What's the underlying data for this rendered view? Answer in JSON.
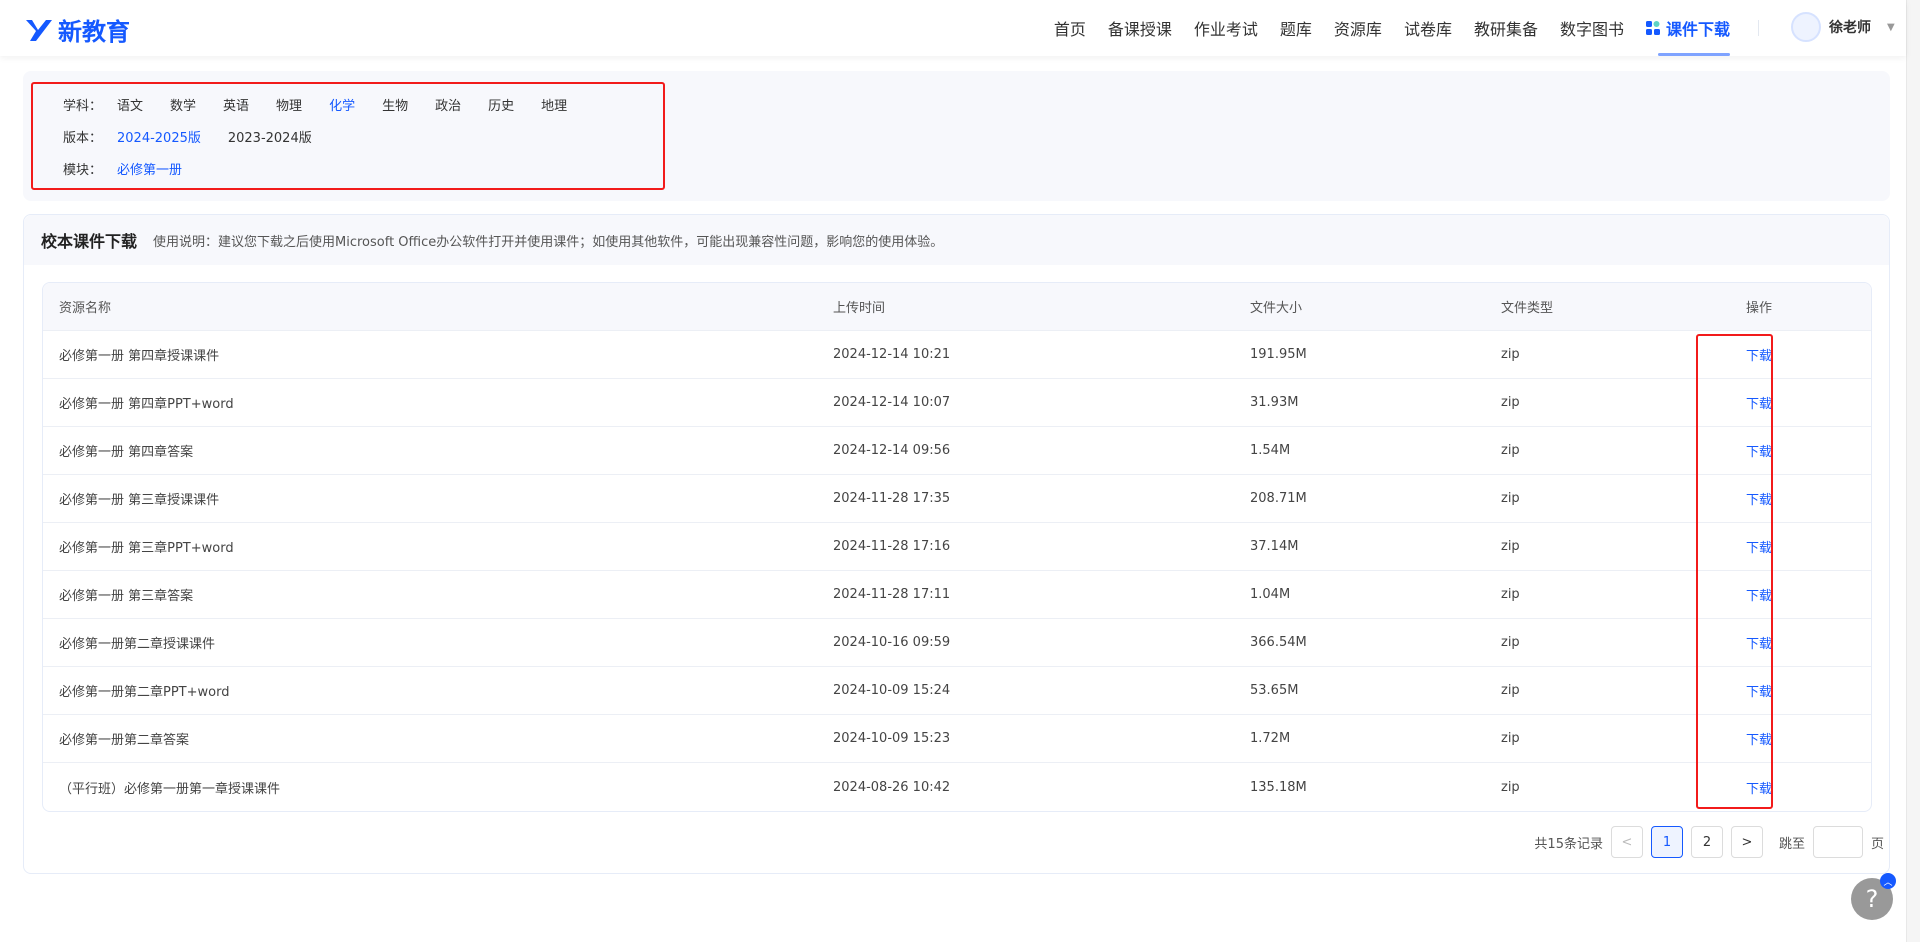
{
  "logo": {
    "text": "新教育"
  },
  "nav": {
    "items": [
      "首页",
      "备课授课",
      "作业考试",
      "题库",
      "资源库",
      "试卷库",
      "教研集备",
      "数字图书"
    ],
    "active": "课件下载"
  },
  "user": {
    "name": "徐老师"
  },
  "filters": {
    "subject_label": "学科：",
    "subjects": [
      "语文",
      "数学",
      "英语",
      "物理",
      "化学",
      "生物",
      "政治",
      "历史",
      "地理"
    ],
    "subject_selected": "化学",
    "edition_label": "版本：",
    "editions": [
      "2024-2025版",
      "2023-2024版"
    ],
    "edition_selected": "2024-2025版",
    "module_label": "模块：",
    "modules": [
      "必修第一册"
    ],
    "module_selected": "必修第一册"
  },
  "section": {
    "title": "校本课件下载",
    "note": "使用说明：建议您下载之后使用Microsoft Office办公软件打开并使用课件；如使用其他软件，可能出现兼容性问题，影响您的使用体验。"
  },
  "table": {
    "headers": [
      "资源名称",
      "上传时间",
      "文件大小",
      "文件类型",
      "操作"
    ],
    "rows": [
      [
        "必修第一册 第四章授课课件",
        "2024-12-14 10:21",
        "191.95M",
        "zip",
        "下载"
      ],
      [
        "必修第一册 第四章PPT+word",
        "2024-12-14 10:07",
        "31.93M",
        "zip",
        "下载"
      ],
      [
        "必修第一册 第四章答案",
        "2024-12-14 09:56",
        "1.54M",
        "zip",
        "下载"
      ],
      [
        "必修第一册 第三章授课课件",
        "2024-11-28 17:35",
        "208.71M",
        "zip",
        "下载"
      ],
      [
        "必修第一册 第三章PPT+word",
        "2024-11-28 17:16",
        "37.14M",
        "zip",
        "下载"
      ],
      [
        "必修第一册 第三章答案",
        "2024-11-28 17:11",
        "1.04M",
        "zip",
        "下载"
      ],
      [
        "必修第一册第二章授课课件",
        "2024-10-16 09:59",
        "366.54M",
        "zip",
        "下载"
      ],
      [
        "必修第一册第二章PPT+word",
        "2024-10-09 15:24",
        "53.65M",
        "zip",
        "下载"
      ],
      [
        "必修第一册第二章答案",
        "2024-10-09 15:23",
        "1.72M",
        "zip",
        "下载"
      ],
      [
        "（平行班）必修第一册第一章授课课件",
        "2024-08-26 10:42",
        "135.18M",
        "zip",
        "下载"
      ]
    ]
  },
  "pagination": {
    "total": "共15条记录",
    "prev": "<",
    "pages": [
      "1",
      "2"
    ],
    "current": "1",
    "next": ">",
    "jump_label": "跳至",
    "page_suffix": "页"
  },
  "help": {
    "label": "?"
  }
}
